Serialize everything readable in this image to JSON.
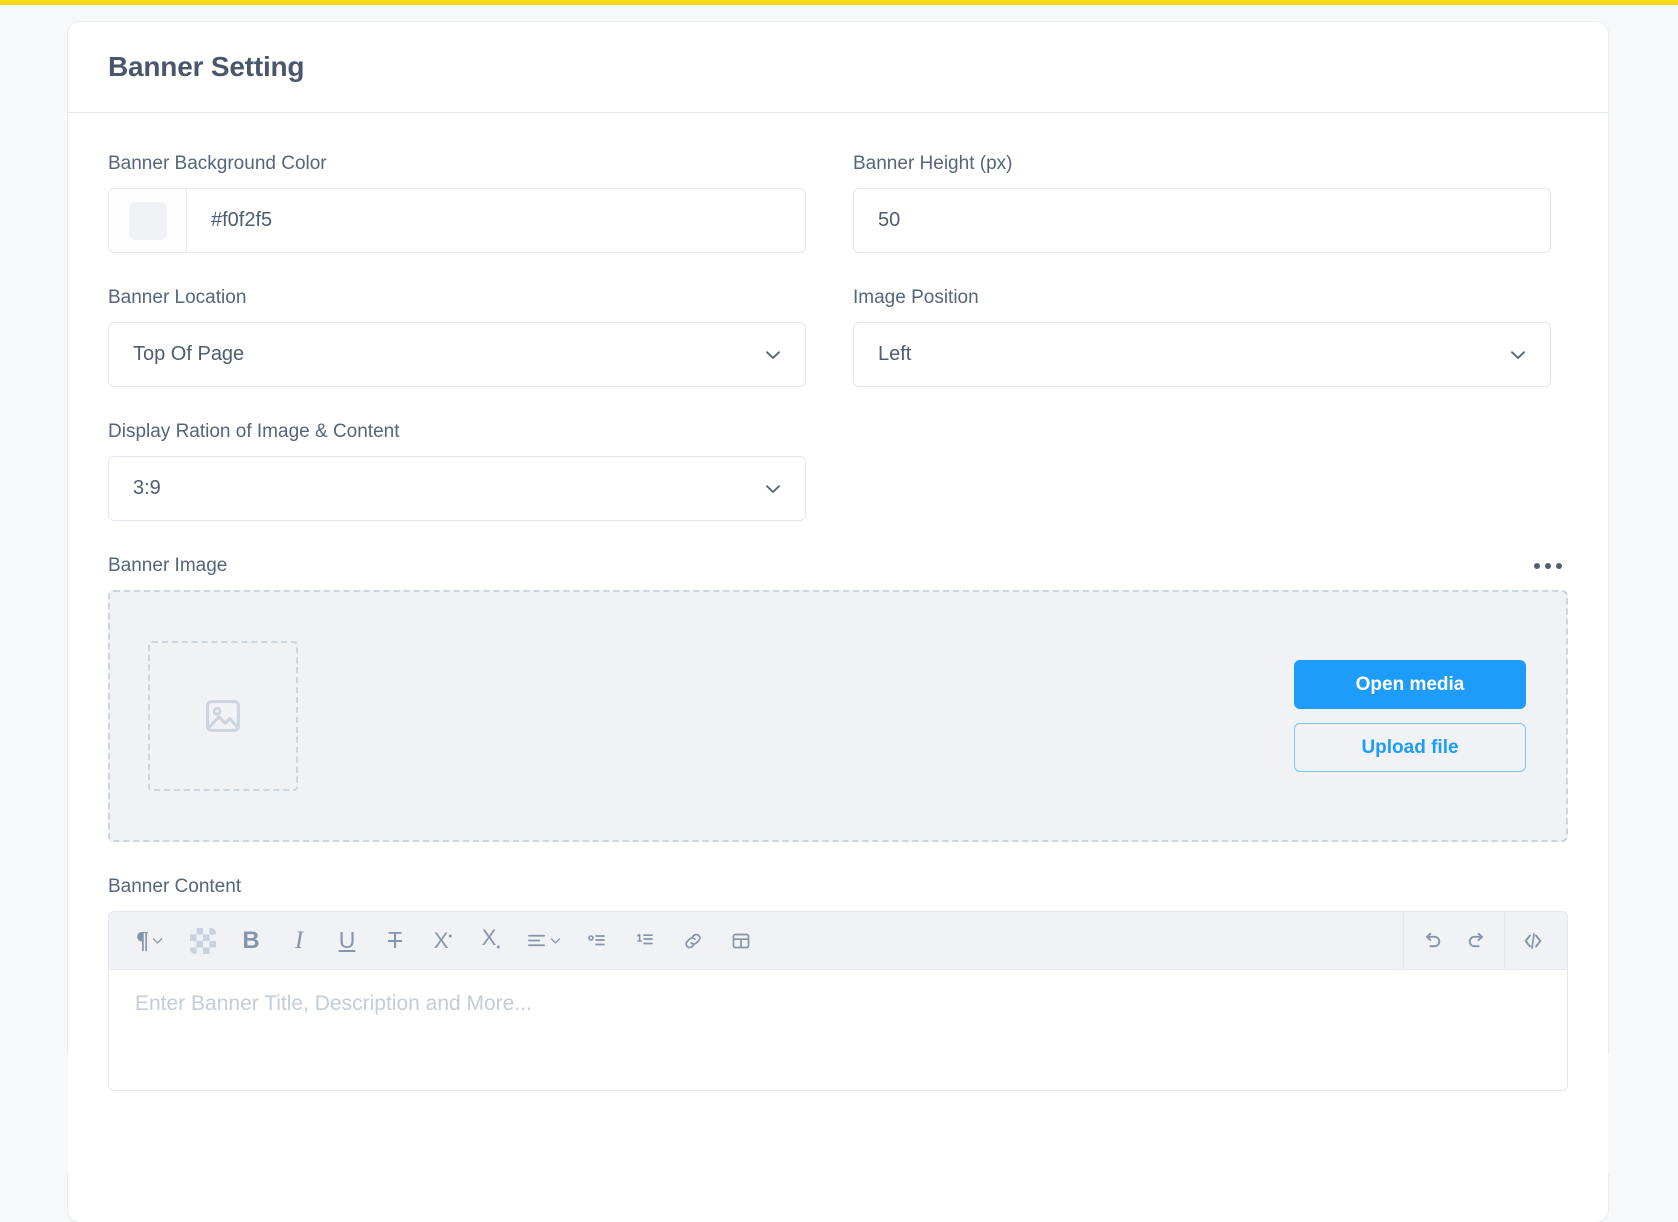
{
  "window": {
    "background_color": "#f7f8fa",
    "loading_bar_color": "#f7d716",
    "accent_color": "#1e9cf9"
  },
  "card": {
    "title": "Banner Setting"
  },
  "form": {
    "background_color_field": {
      "label": "Banner Background Color",
      "value": "#f0f2f5",
      "swatch_color": "#f0f2f5"
    },
    "height_field": {
      "label": "Banner Height (px)",
      "value": "50"
    },
    "banner_location_field": {
      "label": "Banner Location",
      "value": "Top Of Page",
      "chevron_icon": "chevron-down-icon"
    },
    "image_position_field": {
      "label": "Image Position",
      "value": "Left",
      "chevron_icon": "chevron-down-icon"
    },
    "display_ratio_field": {
      "label": "Display Ration of Image & Content",
      "value": "3:9",
      "chevron_icon": "chevron-down-icon"
    }
  },
  "banner_image": {
    "label": "Banner Image",
    "more_menu_icon": "ellipsis-icon",
    "placeholder_icon": "image-icon",
    "open_media_label": "Open media",
    "upload_file_label": "Upload file"
  },
  "banner_content": {
    "label": "Banner Content",
    "placeholder": "Enter Banner Title, Description and More...",
    "value": "",
    "toolbar_left": [
      {
        "icon": "paragraph-format-icon",
        "label": "¶",
        "has_chevron": true
      },
      {
        "icon": "background-color-icon",
        "label": ""
      },
      {
        "icon": "bold-icon",
        "label": "B"
      },
      {
        "icon": "italic-icon",
        "label": "I"
      },
      {
        "icon": "underline-icon",
        "label": "U"
      },
      {
        "icon": "strikethrough-icon",
        "label": "S"
      },
      {
        "icon": "superscript-icon",
        "label": "X"
      },
      {
        "icon": "subscript-icon",
        "label": "X"
      },
      {
        "icon": "align-icon",
        "label": "",
        "has_chevron": true
      },
      {
        "icon": "unordered-list-icon",
        "label": ""
      },
      {
        "icon": "ordered-list-icon",
        "label": ""
      },
      {
        "icon": "insert-link-icon",
        "label": ""
      },
      {
        "icon": "insert-table-icon",
        "label": ""
      }
    ],
    "toolbar_right": [
      {
        "icon": "undo-icon",
        "label": ""
      },
      {
        "icon": "redo-icon",
        "label": ""
      },
      {
        "icon": "code-view-icon",
        "label": ""
      }
    ]
  }
}
